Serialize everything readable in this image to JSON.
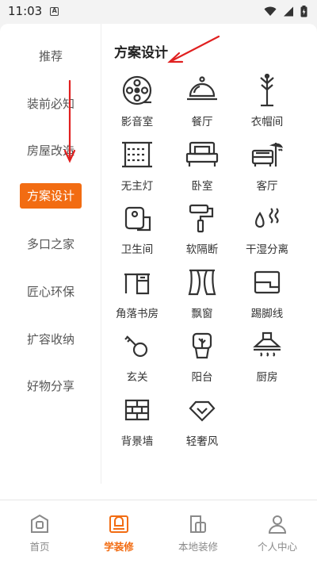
{
  "status_bar": {
    "time": "11:03",
    "notification_glyph": "A"
  },
  "sidebar": {
    "items": [
      {
        "label": "推荐",
        "active": false
      },
      {
        "label": "装前必知",
        "active": false
      },
      {
        "label": "房屋改造",
        "active": false
      },
      {
        "label": "方案设计",
        "active": true
      },
      {
        "label": "多口之家",
        "active": false
      },
      {
        "label": "匠心环保",
        "active": false
      },
      {
        "label": "扩容收纳",
        "active": false
      },
      {
        "label": "好物分享",
        "active": false
      }
    ]
  },
  "content": {
    "section_title": "方案设计",
    "categories": [
      {
        "label": "影音室",
        "icon": "film-reel-icon"
      },
      {
        "label": "餐厅",
        "icon": "cloche-icon"
      },
      {
        "label": "衣帽间",
        "icon": "coat-rack-icon"
      },
      {
        "label": "无主灯",
        "icon": "ceiling-lights-icon"
      },
      {
        "label": "卧室",
        "icon": "bed-icon"
      },
      {
        "label": "客厅",
        "icon": "sofa-lamp-icon"
      },
      {
        "label": "卫生间",
        "icon": "toilet-paper-icon"
      },
      {
        "label": "软隔断",
        "icon": "paint-roller-icon"
      },
      {
        "label": "干湿分离",
        "icon": "drops-icon"
      },
      {
        "label": "角落书房",
        "icon": "desk-icon"
      },
      {
        "label": "飘窗",
        "icon": "curtain-icon"
      },
      {
        "label": "踢脚线",
        "icon": "baseboard-icon"
      },
      {
        "label": "玄关",
        "icon": "key-icon"
      },
      {
        "label": "阳台",
        "icon": "plant-pot-icon"
      },
      {
        "label": "厨房",
        "icon": "range-hood-icon"
      },
      {
        "label": "背景墙",
        "icon": "brick-wall-icon"
      },
      {
        "label": "轻奢风",
        "icon": "diamond-icon"
      }
    ]
  },
  "bottom_nav": {
    "items": [
      {
        "label": "首页",
        "icon": "home-icon",
        "active": false
      },
      {
        "label": "学装修",
        "icon": "book-icon",
        "active": true
      },
      {
        "label": "本地装修",
        "icon": "local-icon",
        "active": false
      },
      {
        "label": "个人中心",
        "icon": "person-icon",
        "active": false
      }
    ]
  },
  "colors": {
    "accent": "#f26c12",
    "annotation_arrow": "#e02020",
    "icon_stroke": "#333333"
  }
}
